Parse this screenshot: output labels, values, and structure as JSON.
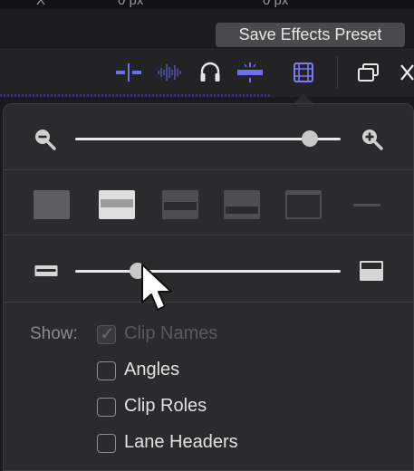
{
  "header": {
    "save_preset_label": "Save Effects Preset",
    "partial_top_left": "X",
    "partial_top_value1": "0 px",
    "partial_top_value2": "0 px"
  },
  "toolbar": {
    "icons": [
      "audio-skimming-icon",
      "audio-waveform-icon",
      "headphones-icon",
      "snapping-icon",
      "clip-appearance-icon",
      "window-layout-icon",
      "close-x-icon"
    ],
    "active_color": "#6e6ef0"
  },
  "appearance": {
    "zoom_slider": {
      "min_icon": "zoom-out-icon",
      "max_icon": "zoom-in-icon",
      "value": 0.88
    },
    "clip_height_options": [
      "audio-only",
      "large-audio",
      "audio-video-balanced",
      "large-video",
      "video-only",
      "filmstrip-only"
    ],
    "clip_height_selected": 1,
    "clip_height_slider": {
      "value": 0.1
    },
    "show_label": "Show:",
    "checkboxes": [
      {
        "label": "Clip Names",
        "checked": true,
        "disabled": true
      },
      {
        "label": "Angles",
        "checked": false,
        "disabled": false
      },
      {
        "label": "Clip Roles",
        "checked": false,
        "disabled": false
      },
      {
        "label": "Lane Headers",
        "checked": false,
        "disabled": false
      }
    ]
  }
}
